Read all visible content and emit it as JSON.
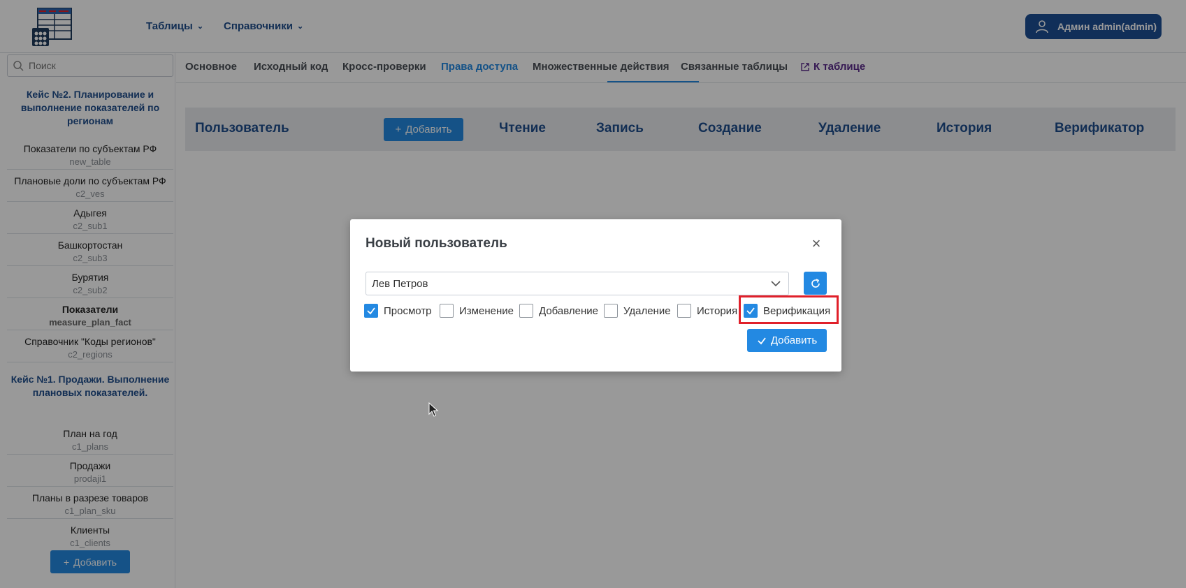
{
  "header": {
    "menu": [
      {
        "label": "Таблицы"
      },
      {
        "label": "Справочники"
      }
    ],
    "user": {
      "label": "Админ admin(admin)"
    }
  },
  "sidebar": {
    "search_placeholder": "Поиск",
    "groups": [
      {
        "title": "Кейс №2. Планирование и выполнение показателей по регионам"
      },
      {
        "title": "Кейс №1. Продажи. Выполнение плановых показателей."
      }
    ],
    "items": [
      {
        "title": "Показатели по субъектам РФ",
        "sub": "new_table"
      },
      {
        "title": "Плановые доли по субъектам РФ",
        "sub": "c2_ves"
      },
      {
        "title": "Адыгея",
        "sub": "c2_sub1"
      },
      {
        "title": "Башкортостан",
        "sub": "c2_sub3"
      },
      {
        "title": "Бурятия",
        "sub": "c2_sub2"
      },
      {
        "title": "Показатели",
        "sub": "measure_plan_fact"
      },
      {
        "title": "Справочник \"Коды регионов\"",
        "sub": "c2_regions"
      },
      {
        "title": "План на год",
        "sub": "c1_plans"
      },
      {
        "title": "Продажи",
        "sub": "prodaji1"
      },
      {
        "title": "Планы в разрезе товаров",
        "sub": "c1_plan_sku"
      },
      {
        "title": "Клиенты",
        "sub": "c1_clients"
      }
    ],
    "add_label": "Добавить"
  },
  "tabs": [
    {
      "label": "Основное"
    },
    {
      "label": "Исходный код"
    },
    {
      "label": "Кросс-проверки"
    },
    {
      "label": "Права доступа"
    },
    {
      "label": "Множественные действия"
    },
    {
      "label": "Связанные таблицы"
    },
    {
      "label": "К таблице"
    }
  ],
  "table": {
    "columns": [
      "Пользователь",
      "Чтение",
      "Запись",
      "Создание",
      "Удаление",
      "История",
      "Верификатор"
    ],
    "add_label": "Добавить"
  },
  "modal": {
    "title": "Новый пользователь",
    "selected_user": "Лев Петров",
    "checkboxes": [
      {
        "label": "Просмотр",
        "checked": true
      },
      {
        "label": "Изменение",
        "checked": false
      },
      {
        "label": "Добавление",
        "checked": false
      },
      {
        "label": "Удаление",
        "checked": false
      },
      {
        "label": "История",
        "checked": false
      },
      {
        "label": "Верификация",
        "checked": true
      }
    ],
    "add_label": "Добавить"
  },
  "colors": {
    "accent": "#2389e2",
    "brand_dark": "#1d4f95",
    "highlight": "#e0202a"
  }
}
